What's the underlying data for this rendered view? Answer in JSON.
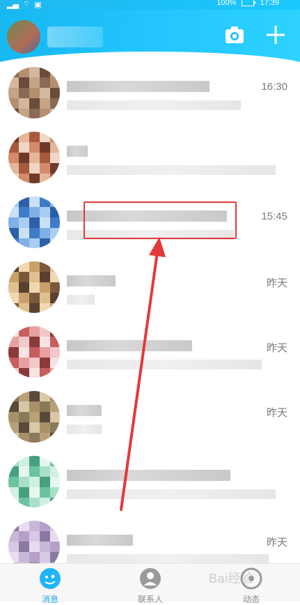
{
  "status_bar": {
    "battery": "100%",
    "time": "17:39"
  },
  "header": {
    "icons": [
      "camera-icon",
      "plus-icon"
    ]
  },
  "conversations": [
    {
      "time": "16:30"
    },
    {
      "time": ""
    },
    {
      "time": "15:45"
    },
    {
      "time": "昨天"
    },
    {
      "time": "昨天"
    },
    {
      "time": "昨天"
    },
    {
      "time": ""
    },
    {
      "time": "昨天"
    }
  ],
  "tabbar": {
    "tabs": [
      {
        "label": "消息",
        "icon": "message-tab-icon",
        "active": true
      },
      {
        "label": "联系人",
        "icon": "contacts-tab-icon",
        "active": false
      },
      {
        "label": "动态",
        "icon": "dynamic-tab-icon",
        "active": false
      }
    ]
  },
  "watermark": "Bai经验",
  "colors": {
    "header_blue": "#1fc1ff",
    "annotation_red": "#e23a3a"
  }
}
